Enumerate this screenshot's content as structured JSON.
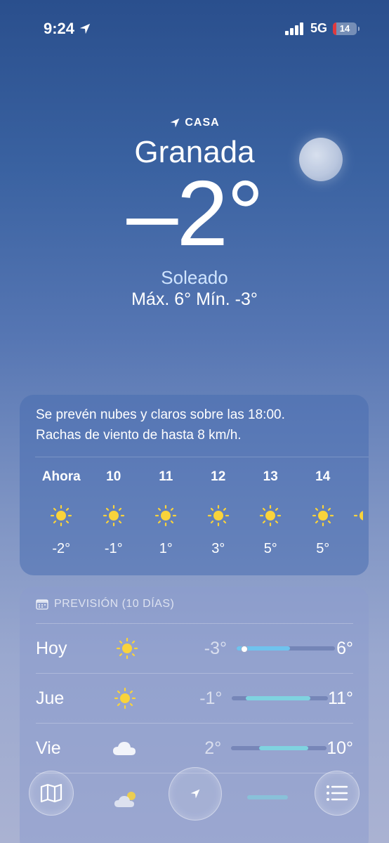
{
  "status_bar": {
    "time": "9:24",
    "network": "5G",
    "battery": "14",
    "battery_level": 0.14,
    "battery_color": "#e0393e"
  },
  "location": {
    "caption": "CASA",
    "city": "Granada",
    "temperature": "–2°",
    "condition": "Soleado",
    "hilo": "Máx. 6°  Mín. -3°"
  },
  "hourly": {
    "summary_line1": "Se prevén nubes y claros sobre las 18:00.",
    "summary_line2": "Rachas de viento de hasta 8 km/h.",
    "hours": [
      {
        "label": "Ahora",
        "icon": "sun-icon",
        "temp": "-2°"
      },
      {
        "label": "10",
        "icon": "sun-icon",
        "temp": "-1°"
      },
      {
        "label": "11",
        "icon": "sun-icon",
        "temp": "1°"
      },
      {
        "label": "12",
        "icon": "sun-icon",
        "temp": "3°"
      },
      {
        "label": "13",
        "icon": "sun-icon",
        "temp": "5°"
      },
      {
        "label": "14",
        "icon": "sun-icon",
        "temp": "5°"
      }
    ]
  },
  "forecast": {
    "header": "PREVISIÓN (10 DÍAS)",
    "rows": [
      {
        "day": "Hoy",
        "icon": "sun-icon",
        "low": "-3°",
        "high": "6°",
        "bar_color": "#6fc3ee"
      },
      {
        "day": "Jue",
        "icon": "sun-icon",
        "low": "-1°",
        "high": "11°",
        "bar_color": "#7fd3e0"
      },
      {
        "day": "Vie",
        "icon": "cloud-icon",
        "low": "2°",
        "high": "10°",
        "bar_color": "#7fd3e0"
      }
    ]
  },
  "toolbar": {
    "map_icon": "map-icon",
    "location_icon": "location-arrow-icon",
    "list_icon": "list-icon"
  }
}
